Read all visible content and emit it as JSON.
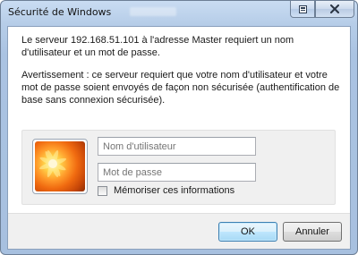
{
  "window": {
    "title": "Sécurité de Windows",
    "icons": {
      "help": "help-icon",
      "close": "close-icon"
    }
  },
  "message": {
    "line1": "Le serveur 192.168.51.101 à l'adresse Master requiert un nom d'utilisateur et un mot de passe.",
    "warning": "Avertissement : ce serveur requiert que votre nom d'utilisateur et votre mot de passe soient envoyés de façon non sécurisée (authentification de base sans connexion sécurisée)."
  },
  "credentials": {
    "username_placeholder": "Nom d'utilisateur",
    "password_placeholder": "Mot de passe",
    "remember_label": "Mémoriser ces informations",
    "remember_checked": false,
    "avatar_icon": "user-flower-avatar-icon"
  },
  "buttons": {
    "ok": "OK",
    "cancel": "Annuler"
  }
}
